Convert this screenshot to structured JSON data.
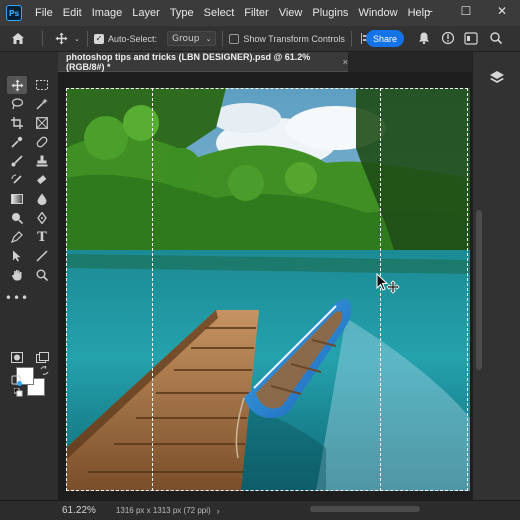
{
  "app": {
    "logo": "Ps"
  },
  "menu": [
    "File",
    "Edit",
    "Image",
    "Layer",
    "Type",
    "Select",
    "Filter",
    "View",
    "Plugins",
    "Window",
    "Help"
  ],
  "window_controls": {
    "minimize": "–",
    "maximize": "☐",
    "close": "✕"
  },
  "options_bar": {
    "auto_select_label": "Auto-Select:",
    "auto_select_checked": true,
    "auto_select_target": "Group",
    "transform_controls_label": "Show Transform Controls",
    "transform_controls_checked": false,
    "share_label": "Share"
  },
  "document_tab": {
    "title": "photoshop tips and tricks (LBN DESIGNER).psd @ 61.2% (RGB/8#) *",
    "close": "×"
  },
  "status": {
    "zoom": "61.22%",
    "doc_info": "1316 px x 1313 px (72 ppi)"
  },
  "colors": {
    "accent": "#1473e6",
    "foreground_swatch": "#ffffff",
    "background_swatch": "#ffffff"
  }
}
